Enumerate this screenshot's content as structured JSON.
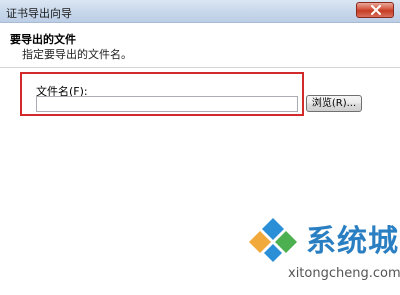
{
  "window": {
    "title": "证书导出向导",
    "close_icon": "close-icon"
  },
  "header": {
    "title": "要导出的文件",
    "subtitle": "指定要导出的文件名。"
  },
  "form": {
    "file_label": "文件名(F):",
    "file_value": "",
    "browse_label": "浏览(R)..."
  },
  "watermark": {
    "brand_text": "系统城",
    "domain": "xitongcheng.com",
    "logo_icon": "diamond-logo-icon"
  },
  "colors": {
    "highlight": "#d22a2a",
    "brand": "#2a7fc2",
    "close_button": "#c53c24"
  }
}
